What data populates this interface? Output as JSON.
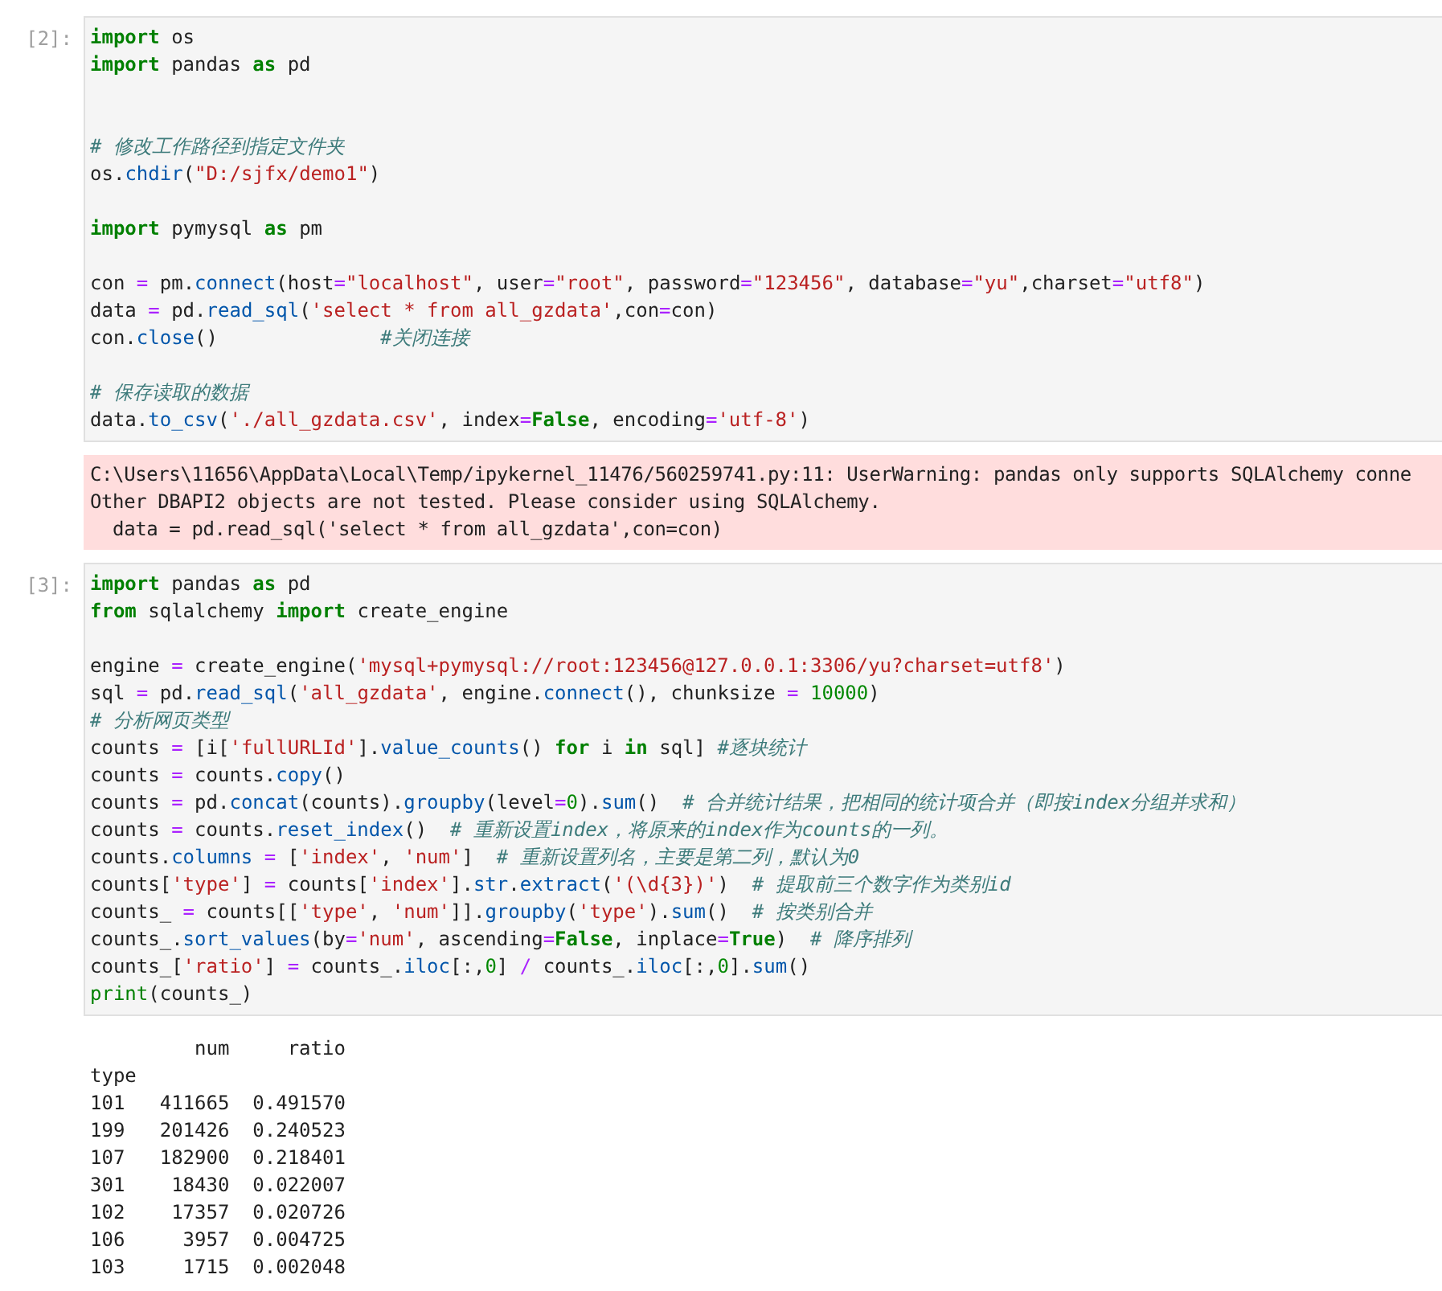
{
  "cells": [
    {
      "prompt": "[2]:",
      "code": [
        {
          "kind": "code",
          "tokens": [
            {
              "kind": "kw",
              "text": "import"
            },
            {
              "kind": "pl",
              "text": " os"
            }
          ]
        },
        {
          "kind": "code",
          "tokens": [
            {
              "kind": "kw",
              "text": "import"
            },
            {
              "kind": "pl",
              "text": " pandas "
            },
            {
              "kind": "kw",
              "text": "as"
            },
            {
              "kind": "pl",
              "text": " pd"
            }
          ]
        },
        {
          "kind": "blank"
        },
        {
          "kind": "blank"
        },
        {
          "kind": "code",
          "tokens": [
            {
              "kind": "cm",
              "text": "# 修改工作路径到指定文件夹"
            }
          ]
        },
        {
          "kind": "code",
          "tokens": [
            {
              "kind": "pl",
              "text": "os."
            },
            {
              "kind": "fn",
              "text": "chdir"
            },
            {
              "kind": "pl",
              "text": "("
            },
            {
              "kind": "st",
              "text": "\"D:/sjfx/demo1\""
            },
            {
              "kind": "pl",
              "text": ")"
            }
          ]
        },
        {
          "kind": "blank"
        },
        {
          "kind": "code",
          "tokens": [
            {
              "kind": "kw",
              "text": "import"
            },
            {
              "kind": "pl",
              "text": " pymysql "
            },
            {
              "kind": "kw",
              "text": "as"
            },
            {
              "kind": "pl",
              "text": " pm"
            }
          ]
        },
        {
          "kind": "blank"
        },
        {
          "kind": "code",
          "tokens": [
            {
              "kind": "pl",
              "text": "con "
            },
            {
              "kind": "op",
              "text": "="
            },
            {
              "kind": "pl",
              "text": " pm."
            },
            {
              "kind": "fn",
              "text": "connect"
            },
            {
              "kind": "pl",
              "text": "(host"
            },
            {
              "kind": "op",
              "text": "="
            },
            {
              "kind": "st",
              "text": "\"localhost\""
            },
            {
              "kind": "pl",
              "text": ", user"
            },
            {
              "kind": "op",
              "text": "="
            },
            {
              "kind": "st",
              "text": "\"root\""
            },
            {
              "kind": "pl",
              "text": ", password"
            },
            {
              "kind": "op",
              "text": "="
            },
            {
              "kind": "st",
              "text": "\"123456\""
            },
            {
              "kind": "pl",
              "text": ", database"
            },
            {
              "kind": "op",
              "text": "="
            },
            {
              "kind": "st",
              "text": "\"yu\""
            },
            {
              "kind": "pl",
              "text": ",charset"
            },
            {
              "kind": "op",
              "text": "="
            },
            {
              "kind": "st",
              "text": "\"utf8\""
            },
            {
              "kind": "pl",
              "text": ")"
            }
          ]
        },
        {
          "kind": "code",
          "tokens": [
            {
              "kind": "pl",
              "text": "data "
            },
            {
              "kind": "op",
              "text": "="
            },
            {
              "kind": "pl",
              "text": " pd."
            },
            {
              "kind": "fn",
              "text": "read_sql"
            },
            {
              "kind": "pl",
              "text": "("
            },
            {
              "kind": "st",
              "text": "'select * from all_gzdata'"
            },
            {
              "kind": "pl",
              "text": ",con"
            },
            {
              "kind": "op",
              "text": "="
            },
            {
              "kind": "pl",
              "text": "con)"
            }
          ]
        },
        {
          "kind": "code",
          "tokens": [
            {
              "kind": "pl",
              "text": "con."
            },
            {
              "kind": "fn",
              "text": "close"
            },
            {
              "kind": "pl",
              "text": "()              "
            },
            {
              "kind": "cm",
              "text": "#关闭连接"
            }
          ]
        },
        {
          "kind": "blank"
        },
        {
          "kind": "code",
          "tokens": [
            {
              "kind": "cm",
              "text": "# 保存读取的数据"
            }
          ]
        },
        {
          "kind": "code",
          "tokens": [
            {
              "kind": "pl",
              "text": "data."
            },
            {
              "kind": "fn",
              "text": "to_csv"
            },
            {
              "kind": "pl",
              "text": "("
            },
            {
              "kind": "st",
              "text": "'./all_gzdata.csv'"
            },
            {
              "kind": "pl",
              "text": ", index"
            },
            {
              "kind": "op",
              "text": "="
            },
            {
              "kind": "kw",
              "text": "False"
            },
            {
              "kind": "pl",
              "text": ", encoding"
            },
            {
              "kind": "op",
              "text": "="
            },
            {
              "kind": "st",
              "text": "'utf-8'"
            },
            {
              "kind": "pl",
              "text": ")"
            }
          ]
        }
      ],
      "outputs": [
        {
          "kind": "stderr",
          "lines": [
            "C:\\Users\\11656\\AppData\\Local\\Temp/ipykernel_11476/560259741.py:11: UserWarning: pandas only supports SQLAlchemy conne",
            "Other DBAPI2 objects are not tested. Please consider using SQLAlchemy.",
            "  data = pd.read_sql('select * from all_gzdata',con=con)"
          ]
        }
      ]
    },
    {
      "prompt": "[3]:",
      "code": [
        {
          "kind": "code",
          "tokens": [
            {
              "kind": "kw",
              "text": "import"
            },
            {
              "kind": "pl",
              "text": " pandas "
            },
            {
              "kind": "kw",
              "text": "as"
            },
            {
              "kind": "pl",
              "text": " pd"
            }
          ]
        },
        {
          "kind": "code",
          "tokens": [
            {
              "kind": "kw",
              "text": "from"
            },
            {
              "kind": "pl",
              "text": " sqlalchemy "
            },
            {
              "kind": "kw",
              "text": "import"
            },
            {
              "kind": "pl",
              "text": " create_engine"
            }
          ]
        },
        {
          "kind": "blank"
        },
        {
          "kind": "code",
          "tokens": [
            {
              "kind": "pl",
              "text": "engine "
            },
            {
              "kind": "op",
              "text": "="
            },
            {
              "kind": "pl",
              "text": " create_engine("
            },
            {
              "kind": "st",
              "text": "'mysql+pymysql://root:123456@127.0.0.1:3306/yu?charset=utf8'"
            },
            {
              "kind": "pl",
              "text": ")"
            }
          ]
        },
        {
          "kind": "code",
          "tokens": [
            {
              "kind": "pl",
              "text": "sql "
            },
            {
              "kind": "op",
              "text": "="
            },
            {
              "kind": "pl",
              "text": " pd."
            },
            {
              "kind": "fn",
              "text": "read_sql"
            },
            {
              "kind": "pl",
              "text": "("
            },
            {
              "kind": "st",
              "text": "'all_gzdata'"
            },
            {
              "kind": "pl",
              "text": ", engine."
            },
            {
              "kind": "fn",
              "text": "connect"
            },
            {
              "kind": "pl",
              "text": "(), chunksize "
            },
            {
              "kind": "op",
              "text": "="
            },
            {
              "kind": "nu",
              "text": " 10000"
            },
            {
              "kind": "pl",
              "text": ")"
            }
          ]
        },
        {
          "kind": "code",
          "tokens": [
            {
              "kind": "cm",
              "text": "# 分析网页类型"
            }
          ]
        },
        {
          "kind": "code",
          "tokens": [
            {
              "kind": "pl",
              "text": "counts "
            },
            {
              "kind": "op",
              "text": "="
            },
            {
              "kind": "pl",
              "text": " [i["
            },
            {
              "kind": "st",
              "text": "'fullURLId'"
            },
            {
              "kind": "pl",
              "text": "]."
            },
            {
              "kind": "fn",
              "text": "value_counts"
            },
            {
              "kind": "pl",
              "text": "() "
            },
            {
              "kind": "kw",
              "text": "for"
            },
            {
              "kind": "pl",
              "text": " i "
            },
            {
              "kind": "kw",
              "text": "in"
            },
            {
              "kind": "pl",
              "text": " sql] "
            },
            {
              "kind": "cm",
              "text": "#逐块统计"
            }
          ]
        },
        {
          "kind": "code",
          "tokens": [
            {
              "kind": "pl",
              "text": "counts "
            },
            {
              "kind": "op",
              "text": "="
            },
            {
              "kind": "pl",
              "text": " counts."
            },
            {
              "kind": "fn",
              "text": "copy"
            },
            {
              "kind": "pl",
              "text": "()"
            }
          ]
        },
        {
          "kind": "code",
          "tokens": [
            {
              "kind": "pl",
              "text": "counts "
            },
            {
              "kind": "op",
              "text": "="
            },
            {
              "kind": "pl",
              "text": " pd."
            },
            {
              "kind": "fn",
              "text": "concat"
            },
            {
              "kind": "pl",
              "text": "(counts)."
            },
            {
              "kind": "fn",
              "text": "groupby"
            },
            {
              "kind": "pl",
              "text": "(level"
            },
            {
              "kind": "op",
              "text": "="
            },
            {
              "kind": "nu",
              "text": "0"
            },
            {
              "kind": "pl",
              "text": ")."
            },
            {
              "kind": "fn",
              "text": "sum"
            },
            {
              "kind": "pl",
              "text": "()  "
            },
            {
              "kind": "cm",
              "text": "# 合并统计结果，把相同的统计项合并（即按index分组并求和）"
            }
          ]
        },
        {
          "kind": "code",
          "tokens": [
            {
              "kind": "pl",
              "text": "counts "
            },
            {
              "kind": "op",
              "text": "="
            },
            {
              "kind": "pl",
              "text": " counts."
            },
            {
              "kind": "fn",
              "text": "reset_index"
            },
            {
              "kind": "pl",
              "text": "()  "
            },
            {
              "kind": "cm",
              "text": "# 重新设置index，将原来的index作为counts的一列。"
            }
          ]
        },
        {
          "kind": "code",
          "tokens": [
            {
              "kind": "pl",
              "text": "counts."
            },
            {
              "kind": "fn",
              "text": "columns"
            },
            {
              "kind": "op",
              "text": " ="
            },
            {
              "kind": "pl",
              "text": " ["
            },
            {
              "kind": "st",
              "text": "'index'"
            },
            {
              "kind": "pl",
              "text": ", "
            },
            {
              "kind": "st",
              "text": "'num'"
            },
            {
              "kind": "pl",
              "text": "]  "
            },
            {
              "kind": "cm",
              "text": "# 重新设置列名，主要是第二列，默认为0"
            }
          ]
        },
        {
          "kind": "code",
          "tokens": [
            {
              "kind": "pl",
              "text": "counts["
            },
            {
              "kind": "st",
              "text": "'type'"
            },
            {
              "kind": "pl",
              "text": "] "
            },
            {
              "kind": "op",
              "text": "="
            },
            {
              "kind": "pl",
              "text": " counts["
            },
            {
              "kind": "st",
              "text": "'index'"
            },
            {
              "kind": "pl",
              "text": "]."
            },
            {
              "kind": "fn",
              "text": "str"
            },
            {
              "kind": "pl",
              "text": "."
            },
            {
              "kind": "fn",
              "text": "extract"
            },
            {
              "kind": "pl",
              "text": "("
            },
            {
              "kind": "st",
              "text": "'(\\d{3})'"
            },
            {
              "kind": "pl",
              "text": ")  "
            },
            {
              "kind": "cm",
              "text": "# 提取前三个数字作为类别id"
            }
          ]
        },
        {
          "kind": "code",
          "tokens": [
            {
              "kind": "pl",
              "text": "counts_ "
            },
            {
              "kind": "op",
              "text": "="
            },
            {
              "kind": "pl",
              "text": " counts[["
            },
            {
              "kind": "st",
              "text": "'type'"
            },
            {
              "kind": "pl",
              "text": ", "
            },
            {
              "kind": "st",
              "text": "'num'"
            },
            {
              "kind": "pl",
              "text": "]]."
            },
            {
              "kind": "fn",
              "text": "groupby"
            },
            {
              "kind": "pl",
              "text": "("
            },
            {
              "kind": "st",
              "text": "'type'"
            },
            {
              "kind": "pl",
              "text": ")."
            },
            {
              "kind": "fn",
              "text": "sum"
            },
            {
              "kind": "pl",
              "text": "()  "
            },
            {
              "kind": "cm",
              "text": "# 按类别合并"
            }
          ]
        },
        {
          "kind": "code",
          "tokens": [
            {
              "kind": "pl",
              "text": "counts_."
            },
            {
              "kind": "fn",
              "text": "sort_values"
            },
            {
              "kind": "pl",
              "text": "(by"
            },
            {
              "kind": "op",
              "text": "="
            },
            {
              "kind": "st",
              "text": "'num'"
            },
            {
              "kind": "pl",
              "text": ", ascending"
            },
            {
              "kind": "op",
              "text": "="
            },
            {
              "kind": "kw",
              "text": "False"
            },
            {
              "kind": "pl",
              "text": ", inplace"
            },
            {
              "kind": "op",
              "text": "="
            },
            {
              "kind": "kw",
              "text": "True"
            },
            {
              "kind": "pl",
              "text": ")  "
            },
            {
              "kind": "cm",
              "text": "# 降序排列"
            }
          ]
        },
        {
          "kind": "code",
          "tokens": [
            {
              "kind": "pl",
              "text": "counts_["
            },
            {
              "kind": "st",
              "text": "'ratio'"
            },
            {
              "kind": "pl",
              "text": "] "
            },
            {
              "kind": "op",
              "text": "="
            },
            {
              "kind": "pl",
              "text": " counts_."
            },
            {
              "kind": "fn",
              "text": "iloc"
            },
            {
              "kind": "pl",
              "text": "[:,"
            },
            {
              "kind": "nu",
              "text": "0"
            },
            {
              "kind": "pl",
              "text": "] "
            },
            {
              "kind": "op",
              "text": "/"
            },
            {
              "kind": "pl",
              "text": " counts_."
            },
            {
              "kind": "fn",
              "text": "iloc"
            },
            {
              "kind": "pl",
              "text": "[:,"
            },
            {
              "kind": "nu",
              "text": "0"
            },
            {
              "kind": "pl",
              "text": "]."
            },
            {
              "kind": "fn",
              "text": "sum"
            },
            {
              "kind": "pl",
              "text": "()"
            }
          ]
        },
        {
          "kind": "code",
          "tokens": [
            {
              "kind": "bi",
              "text": "print"
            },
            {
              "kind": "pl",
              "text": "(counts_)"
            }
          ]
        }
      ],
      "outputs": [
        {
          "kind": "stdout",
          "lines": [
            "         num     ratio",
            "type",
            "101   411665  0.491570",
            "199   201426  0.240523",
            "107   182900  0.218401",
            "301    18430  0.022007",
            "102    17357  0.020726",
            "106     3957  0.004725",
            "103     1715  0.002048"
          ]
        }
      ]
    }
  ]
}
